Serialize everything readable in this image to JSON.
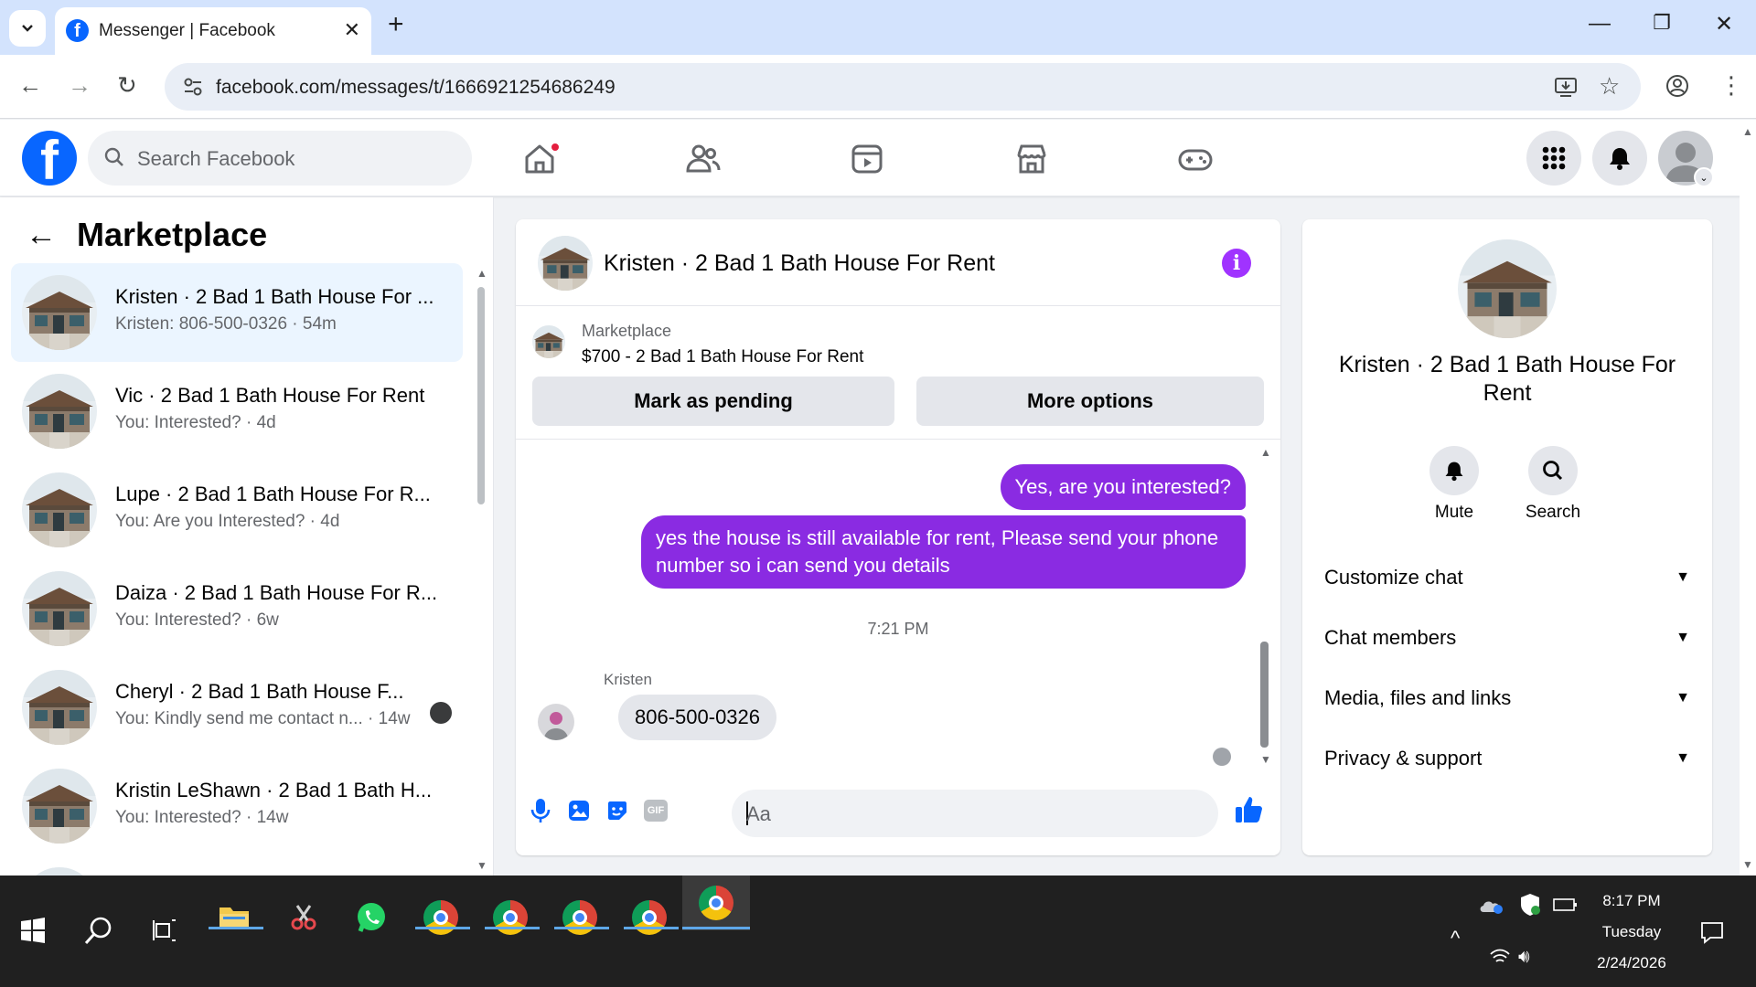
{
  "browser": {
    "tab_title": "Messenger | Facebook",
    "url": "facebook.com/messages/t/1666921254686249"
  },
  "facebook": {
    "search_placeholder": "Search Facebook"
  },
  "sidebar": {
    "title": "Marketplace",
    "conversations": [
      {
        "name": "Kristen · 2 Bad 1 Bath House For ...",
        "snippet": "Kristen: 806-500-0326 · 54m",
        "active": true
      },
      {
        "name": "Vic · 2 Bad 1 Bath House For Rent",
        "snippet": "You: Interested? · 4d"
      },
      {
        "name": "Lupe · 2 Bad 1 Bath House For R...",
        "snippet": "You: Are you Interested? · 4d"
      },
      {
        "name": "Daiza · 2 Bad 1 Bath House For R...",
        "snippet": "You: Interested? · 6w"
      },
      {
        "name": "Cheryl · 2 Bad 1 Bath House F...",
        "snippet": "You: Kindly send me contact n... · 14w"
      },
      {
        "name": "Kristin LeShawn · 2 Bad 1 Bath H...",
        "snippet": "You: Interested? · 14w"
      }
    ]
  },
  "chat": {
    "title": "Kristen · 2 Bad 1 Bath House For Rent",
    "listing": {
      "label": "Marketplace",
      "title": "$700 - 2 Bad 1 Bath House For Rent",
      "mark_pending": "Mark as pending",
      "more_options": "More options"
    },
    "messages_out": [
      "Yes, are you interested?",
      "yes the house is still available for rent, Please send your phone number so i can send you details"
    ],
    "timestamp": "7:21 PM",
    "sender": "Kristen",
    "message_in": "806-500-0326",
    "composer_placeholder": "Aa",
    "gif_label": "GIF"
  },
  "info": {
    "name": "Kristen · 2 Bad 1 Bath House For Rent",
    "actions": [
      {
        "label": "Mute"
      },
      {
        "label": "Search"
      }
    ],
    "sections": [
      "Customize chat",
      "Chat members",
      "Media, files and links",
      "Privacy & support"
    ]
  },
  "taskbar": {
    "time": "8:17 PM",
    "day": "Tuesday",
    "date": "2/24/2026"
  },
  "colors": {
    "fb_blue": "#0866ff",
    "outgoing_bubble": "#8a2be2",
    "info_purple": "#a033ff",
    "chrome_tabbar": "#d3e3fd"
  }
}
